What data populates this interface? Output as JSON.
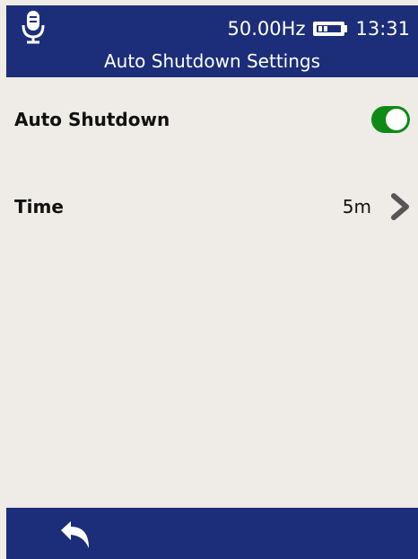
{
  "status_bar": {
    "frequency": "50.00Hz",
    "time": "13:31",
    "mic_icon": "microphone-icon",
    "battery_icon": "battery-icon"
  },
  "header": {
    "title": "Auto Shutdown Settings"
  },
  "settings": {
    "auto_shutdown": {
      "label": "Auto Shutdown",
      "enabled": true
    },
    "time": {
      "label": "Time",
      "value": "5m"
    }
  },
  "footer": {
    "back_icon": "back-arrow-icon"
  },
  "colors": {
    "bar_background": "#1c2e7a",
    "page_background": "#efebe6",
    "toggle_on": "#0e8a16",
    "chevron": "#555555"
  }
}
